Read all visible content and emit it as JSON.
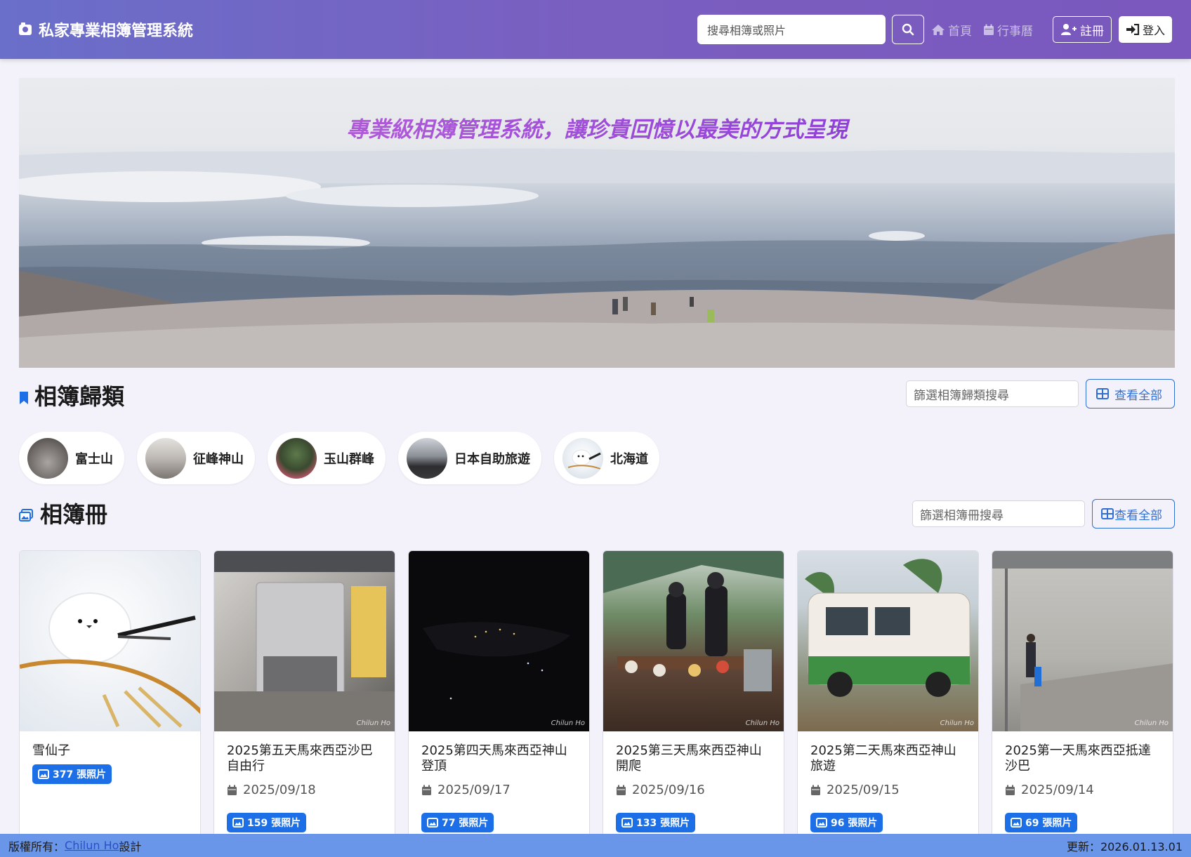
{
  "navbar": {
    "brand": "私家專業相簿管理系統",
    "search_placeholder": "搜尋相簿或照片",
    "links": [
      "首頁",
      "行事曆"
    ],
    "register_label": "註冊",
    "login_label": "登入"
  },
  "hero": {
    "tagline": "專業級相簿管理系統，讓珍貴回憶以最美的方式呈現"
  },
  "categories": {
    "title": "相簿歸類",
    "filter_placeholder": "篩選相簿歸類搜尋",
    "view_all_label": "查看全部",
    "items": [
      {
        "label": "富士山"
      },
      {
        "label": "征峰神山"
      },
      {
        "label": "玉山群峰"
      },
      {
        "label": "日本自助旅遊"
      },
      {
        "label": "北海道"
      }
    ]
  },
  "albums": {
    "title": "相簿冊",
    "filter_placeholder": "篩選相簿冊搜尋",
    "view_all_label": "查看全部",
    "items": [
      {
        "title": "雪仙子",
        "date": "",
        "count": "377 張照片"
      },
      {
        "title": "2025第五天馬來西亞沙巴自由行",
        "date": "2025/09/18",
        "count": "159 張照片"
      },
      {
        "title": "2025第四天馬來西亞神山登頂",
        "date": "2025/09/17",
        "count": "77 張照片"
      },
      {
        "title": "2025第三天馬來西亞神山開爬",
        "date": "2025/09/16",
        "count": "133 張照片"
      },
      {
        "title": "2025第二天馬來西亞神山旅遊",
        "date": "2025/09/15",
        "count": "96 張照片"
      },
      {
        "title": "2025第一天馬來西亞抵達沙巴",
        "date": "2025/09/14",
        "count": "69 張照片"
      }
    ]
  },
  "footer": {
    "copyright_prefix": "版權所有：",
    "author_link": "Chilun Ho",
    "design_suffix": "設計",
    "updated": "更新：2026.01.13.01"
  },
  "colors": {
    "navbar_start": "#6a6fc9",
    "navbar_end": "#7a58bd",
    "accent_blue": "#1d6fe8",
    "footer_bg": "#6a96ea"
  }
}
